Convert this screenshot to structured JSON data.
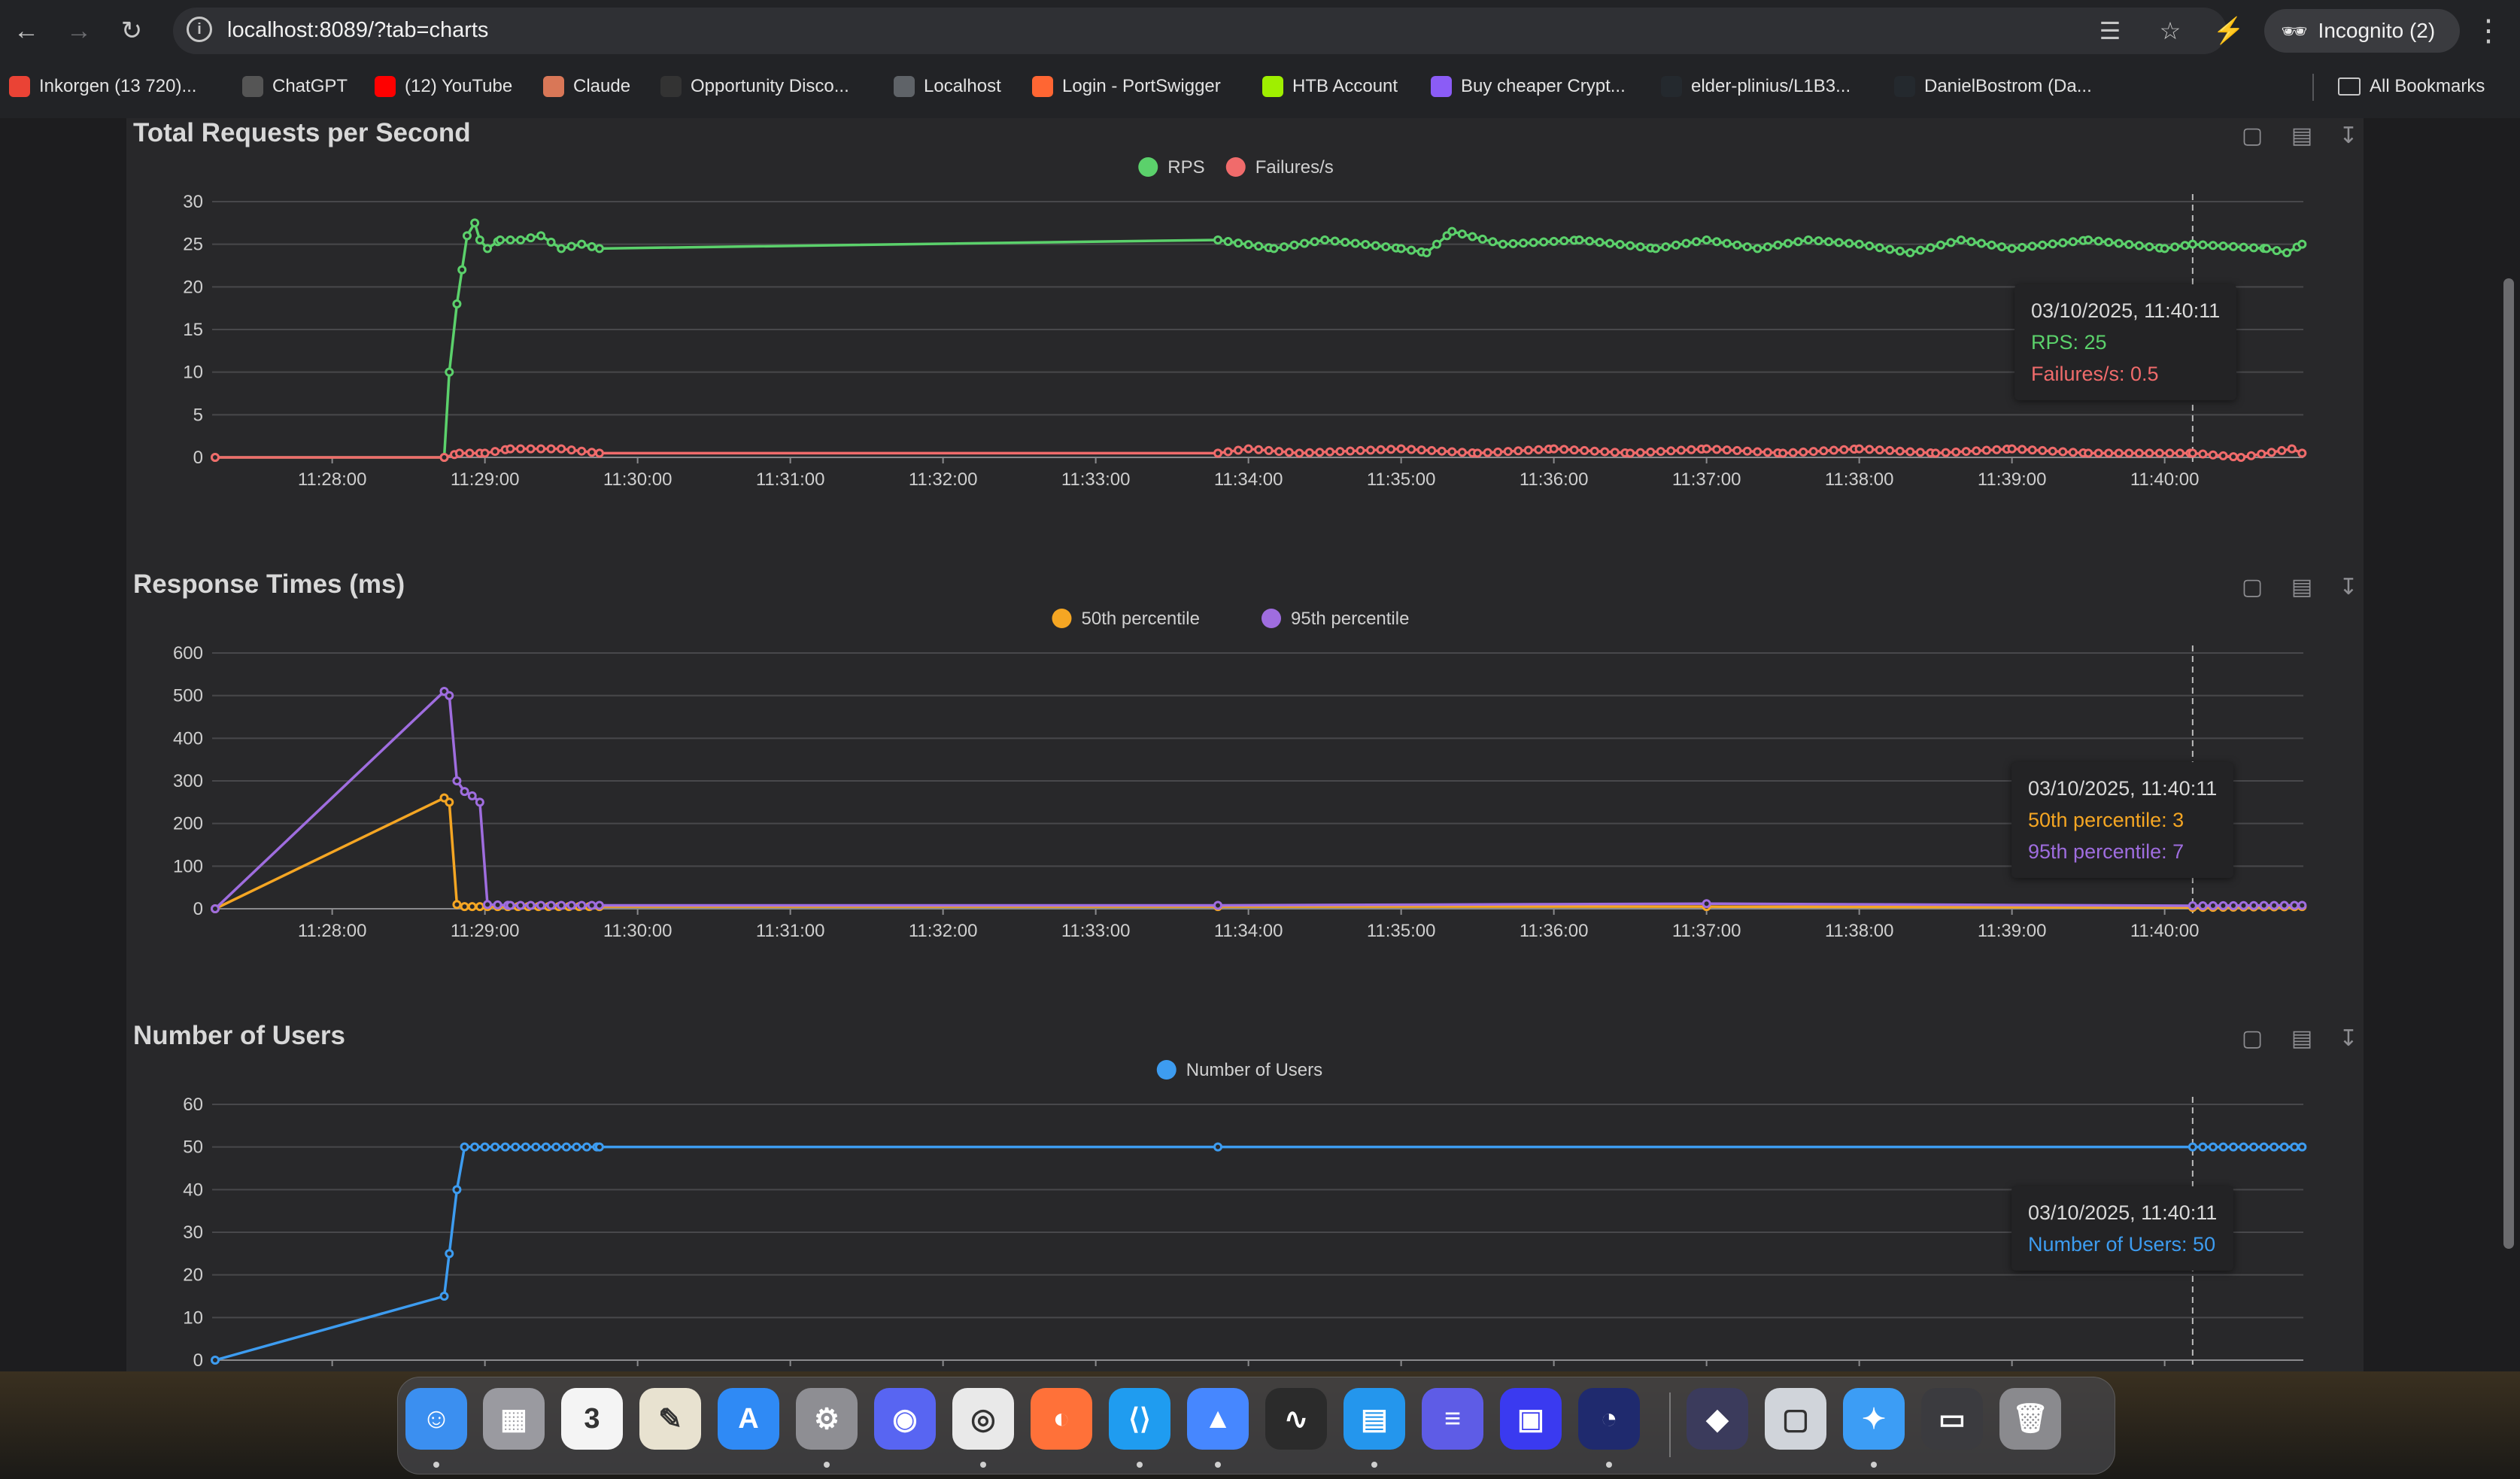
{
  "browser": {
    "url": "localhost:8089/?tab=charts",
    "incognito_label": "Incognito (2)",
    "bookmarks": [
      {
        "label": "Inkorgen (13 720)...",
        "icon": "gmail-icon",
        "color": "#ea4335"
      },
      {
        "label": "ChatGPT",
        "icon": "chatgpt-icon",
        "color": "#555555"
      },
      {
        "label": "(12) YouTube",
        "icon": "youtube-icon",
        "color": "#ff0000"
      },
      {
        "label": "Claude",
        "icon": "claude-icon",
        "color": "#d97757"
      },
      {
        "label": "Opportunity Disco...",
        "icon": "h-icon",
        "color": "#333333"
      },
      {
        "label": "Localhost",
        "icon": "globe-icon",
        "color": "#5f6368"
      },
      {
        "label": "Login - PortSwigger",
        "icon": "portswigger-icon",
        "color": "#ff6633"
      },
      {
        "label": "HTB Account",
        "icon": "htb-icon",
        "color": "#9fef00"
      },
      {
        "label": "Buy cheaper Crypt...",
        "icon": "crypto-icon",
        "color": "#8b5cf6"
      },
      {
        "label": "elder-plinius/L1B3...",
        "icon": "github-icon",
        "color": "#24292e"
      },
      {
        "label": "DanielBostrom (Da...",
        "icon": "github-icon",
        "color": "#24292e"
      }
    ],
    "all_bookmarks_label": "All Bookmarks"
  },
  "time_ticks": [
    "11:28:00",
    "11:29:00",
    "11:30:00",
    "11:31:00",
    "11:32:00",
    "11:33:00",
    "11:34:00",
    "11:35:00",
    "11:36:00",
    "11:37:00",
    "11:38:00",
    "11:39:00",
    "11:40:00"
  ],
  "chart_data": [
    {
      "type": "line",
      "title": "Total Requests per Second",
      "ylim": [
        0,
        30
      ],
      "yticks": [
        0,
        5,
        10,
        15,
        20,
        25,
        30
      ],
      "series": [
        {
          "name": "RPS",
          "color": "#5bd16b",
          "points": [
            [
              "11:27:14",
              0
            ],
            [
              "11:28:44",
              0
            ],
            [
              "11:28:46",
              10
            ],
            [
              "11:28:49",
              18
            ],
            [
              "11:28:51",
              22
            ],
            [
              "11:28:53",
              26
            ],
            [
              "11:28:56",
              27.5
            ],
            [
              "11:28:58",
              25.5
            ],
            [
              "11:29:01",
              24.5
            ],
            [
              "11:29:06",
              25.5
            ],
            [
              "11:29:14",
              25.5
            ],
            [
              "11:29:22",
              26
            ],
            [
              "11:29:30",
              24.5
            ],
            [
              "11:29:38",
              25
            ],
            [
              "11:29:45",
              24.5
            ],
            [
              "11:33:48",
              25.5
            ],
            [
              "11:34:10",
              24.5
            ],
            [
              "11:34:30",
              25.5
            ],
            [
              "11:35:00",
              24.5
            ],
            [
              "11:35:10",
              24
            ],
            [
              "11:35:20",
              26.5
            ],
            [
              "11:35:40",
              25
            ],
            [
              "11:36:10",
              25.5
            ],
            [
              "11:36:40",
              24.5
            ],
            [
              "11:37:00",
              25.5
            ],
            [
              "11:37:20",
              24.5
            ],
            [
              "11:37:40",
              25.5
            ],
            [
              "11:38:00",
              25
            ],
            [
              "11:38:20",
              24
            ],
            [
              "11:38:40",
              25.5
            ],
            [
              "11:39:00",
              24.5
            ],
            [
              "11:39:30",
              25.5
            ],
            [
              "11:40:00",
              24.5
            ],
            [
              "11:40:11",
              25
            ],
            [
              "11:40:40",
              24.5
            ],
            [
              "11:40:48",
              24
            ],
            [
              "11:40:54",
              25
            ]
          ]
        },
        {
          "name": "Failures/s",
          "color": "#f06b6b",
          "points": [
            [
              "11:27:14",
              0
            ],
            [
              "11:28:44",
              0
            ],
            [
              "11:28:50",
              0.5
            ],
            [
              "11:29:00",
              0.5
            ],
            [
              "11:29:10",
              1
            ],
            [
              "11:29:30",
              1
            ],
            [
              "11:29:45",
              0.5
            ],
            [
              "11:33:48",
              0.5
            ],
            [
              "11:34:00",
              1
            ],
            [
              "11:34:20",
              0.5
            ],
            [
              "11:35:00",
              1
            ],
            [
              "11:35:30",
              0.5
            ],
            [
              "11:36:00",
              1
            ],
            [
              "11:36:30",
              0.5
            ],
            [
              "11:37:00",
              1
            ],
            [
              "11:37:30",
              0.5
            ],
            [
              "11:38:00",
              1
            ],
            [
              "11:38:30",
              0.5
            ],
            [
              "11:39:00",
              1
            ],
            [
              "11:39:30",
              0.5
            ],
            [
              "11:40:11",
              0.5
            ],
            [
              "11:40:30",
              0
            ],
            [
              "11:40:50",
              1
            ],
            [
              "11:40:54",
              0.5
            ]
          ]
        }
      ],
      "tooltip": {
        "time": "03/10/2025, 11:40:11",
        "lines": [
          "RPS: 25",
          "Failures/s: 0.5"
        ]
      }
    },
    {
      "type": "line",
      "title": "Response Times (ms)",
      "ylim": [
        0,
        600
      ],
      "yticks": [
        0,
        100,
        200,
        300,
        400,
        500,
        600
      ],
      "series": [
        {
          "name": "50th percentile",
          "color": "#f5a623",
          "points": [
            [
              "11:27:14",
              0
            ],
            [
              "11:28:44",
              260
            ],
            [
              "11:28:46",
              250
            ],
            [
              "11:28:49",
              10
            ],
            [
              "11:28:52",
              5
            ],
            [
              "11:28:55",
              5
            ],
            [
              "11:28:58",
              5
            ],
            [
              "11:29:01",
              5
            ],
            [
              "11:29:45",
              5
            ],
            [
              "11:33:48",
              5
            ],
            [
              "11:37:00",
              5
            ],
            [
              "11:40:11",
              3
            ],
            [
              "11:40:54",
              5
            ]
          ]
        },
        {
          "name": "95th percentile",
          "color": "#9f6ddf",
          "points": [
            [
              "11:27:14",
              0
            ],
            [
              "11:28:44",
              510
            ],
            [
              "11:28:46",
              500
            ],
            [
              "11:28:49",
              300
            ],
            [
              "11:28:52",
              275
            ],
            [
              "11:28:55",
              265
            ],
            [
              "11:28:58",
              250
            ],
            [
              "11:29:01",
              10
            ],
            [
              "11:29:10",
              8
            ],
            [
              "11:29:45",
              8
            ],
            [
              "11:33:48",
              8
            ],
            [
              "11:37:00",
              12
            ],
            [
              "11:40:11",
              7
            ],
            [
              "11:40:54",
              8
            ]
          ]
        }
      ],
      "tooltip": {
        "time": "03/10/2025, 11:40:11",
        "lines": [
          "50th percentile: 3",
          "95th percentile: 7"
        ]
      }
    },
    {
      "type": "line",
      "title": "Number of Users",
      "ylim": [
        0,
        60
      ],
      "yticks": [
        0,
        10,
        20,
        30,
        40,
        50,
        60
      ],
      "series": [
        {
          "name": "Number of Users",
          "color": "#3d9cf0",
          "points": [
            [
              "11:27:14",
              0
            ],
            [
              "11:28:44",
              15
            ],
            [
              "11:28:46",
              25
            ],
            [
              "11:28:49",
              40
            ],
            [
              "11:28:52",
              50
            ],
            [
              "11:29:45",
              50
            ],
            [
              "11:33:48",
              50
            ],
            [
              "11:40:11",
              50
            ],
            [
              "11:40:54",
              50
            ]
          ]
        }
      ],
      "tooltip": {
        "time": "03/10/2025, 11:40:11",
        "lines": [
          "Number of Users: 50"
        ]
      }
    }
  ]
}
